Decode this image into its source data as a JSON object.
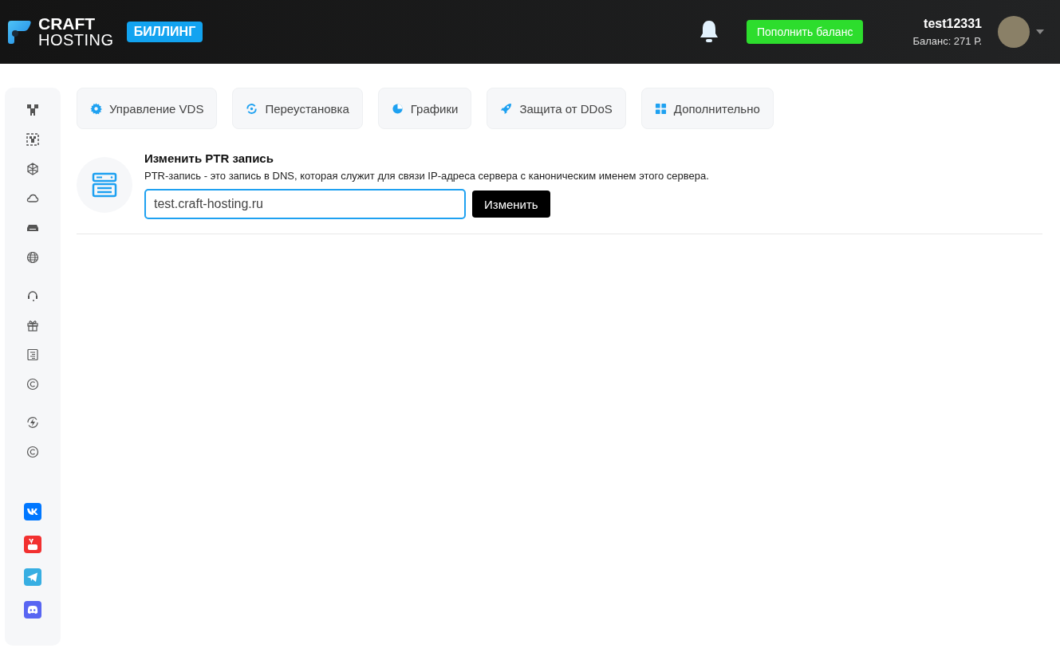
{
  "header": {
    "logo": {
      "line_1": "CRAFT",
      "line_2": "HOSTING"
    },
    "badge": "БИЛЛИНГ",
    "top_up_button": "Пополнить баланс",
    "user": {
      "name": "test12331",
      "balance": "Баланс: 271 Р."
    }
  },
  "tabs": [
    {
      "label": "Управление VDS"
    },
    {
      "label": "Переустановка"
    },
    {
      "label": "Графики"
    },
    {
      "label": "Защита от DDoS"
    },
    {
      "label": "Дополнительно"
    }
  ],
  "ptr": {
    "title": "Изменить PTR запись",
    "description": "PTR-запись - это запись в DNS, которая служит для связи IP-адреса сервера с каноническим именем этого сервера.",
    "input": {
      "value": "test.craft-hosting.ru"
    },
    "button": "Изменить"
  }
}
